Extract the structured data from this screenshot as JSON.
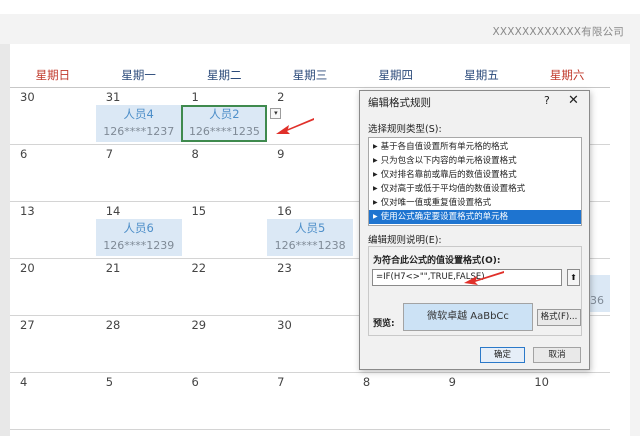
{
  "company": "XXXXXXXXXXXX有限公司",
  "calendar": {
    "weekdays": [
      "星期日",
      "星期一",
      "星期二",
      "星期三",
      "星期四",
      "星期五",
      "星期六"
    ],
    "weekday_colors": [
      "#c0392b",
      "#2b4a7a",
      "#2b4a7a",
      "#2b4a7a",
      "#2b4a7a",
      "#2b4a7a",
      "#c0392b"
    ],
    "weeks": [
      [
        {
          "day": "30"
        },
        {
          "day": "31",
          "person": {
            "name": "人员4",
            "phone": "126****1237"
          }
        },
        {
          "day": "1",
          "person": {
            "name": "人员2",
            "phone": "126****1235"
          },
          "selected": true
        },
        {
          "day": "2"
        },
        {
          "day": ""
        },
        {
          "day": ""
        },
        {
          "day": ""
        }
      ],
      [
        {
          "day": "6"
        },
        {
          "day": "7"
        },
        {
          "day": "8"
        },
        {
          "day": "9"
        },
        {
          "day": ""
        },
        {
          "day": ""
        },
        {
          "day": ""
        }
      ],
      [
        {
          "day": "13"
        },
        {
          "day": "14",
          "person": {
            "name": "人员6",
            "phone": "126****1239"
          }
        },
        {
          "day": "15"
        },
        {
          "day": "16",
          "person": {
            "name": "人员5",
            "phone": "126****1238"
          }
        },
        {
          "day": ""
        },
        {
          "day": ""
        },
        {
          "day": ""
        }
      ],
      [
        {
          "day": "20"
        },
        {
          "day": "21"
        },
        {
          "day": "22"
        },
        {
          "day": "23"
        },
        {
          "day": ""
        },
        {
          "day": ""
        },
        {
          "day": ""
        }
      ],
      [
        {
          "day": "27"
        },
        {
          "day": "28"
        },
        {
          "day": "29"
        },
        {
          "day": "30"
        },
        {
          "day": ""
        },
        {
          "day": ""
        },
        {
          "day": ""
        }
      ],
      [
        {
          "day": "4"
        },
        {
          "day": "5"
        },
        {
          "day": "6"
        },
        {
          "day": "7"
        },
        {
          "day": "8"
        },
        {
          "day": "9"
        },
        {
          "day": "10"
        }
      ]
    ],
    "peek_text": "36"
  },
  "dropdown_glyph": "▾",
  "dialog": {
    "title": "编辑格式规则",
    "help": "?",
    "close": "✕",
    "rule_type_label": "选择规则类型(S):",
    "rule_types": [
      "基于各自值设置所有单元格的格式",
      "只为包含以下内容的单元格设置格式",
      "仅对排名靠前或靠后的数值设置格式",
      "仅对高于或低于平均值的数值设置格式",
      "仅对唯一值或重复值设置格式",
      "使用公式确定要设置格式的单元格"
    ],
    "selected_rule_index": 5,
    "description_label": "编辑规则说明(E):",
    "formula_label": "为符合此公式的值设置格式(O):",
    "formula_value": "=IF(H7<>\"\",TRUE,FALSE)",
    "collapse_glyph": "⬆",
    "preview_label": "预览:",
    "preview_text": "微软卓越 AaBbCc",
    "format_button": "格式(F)...",
    "ok_button": "确定",
    "cancel_button": "取消"
  }
}
